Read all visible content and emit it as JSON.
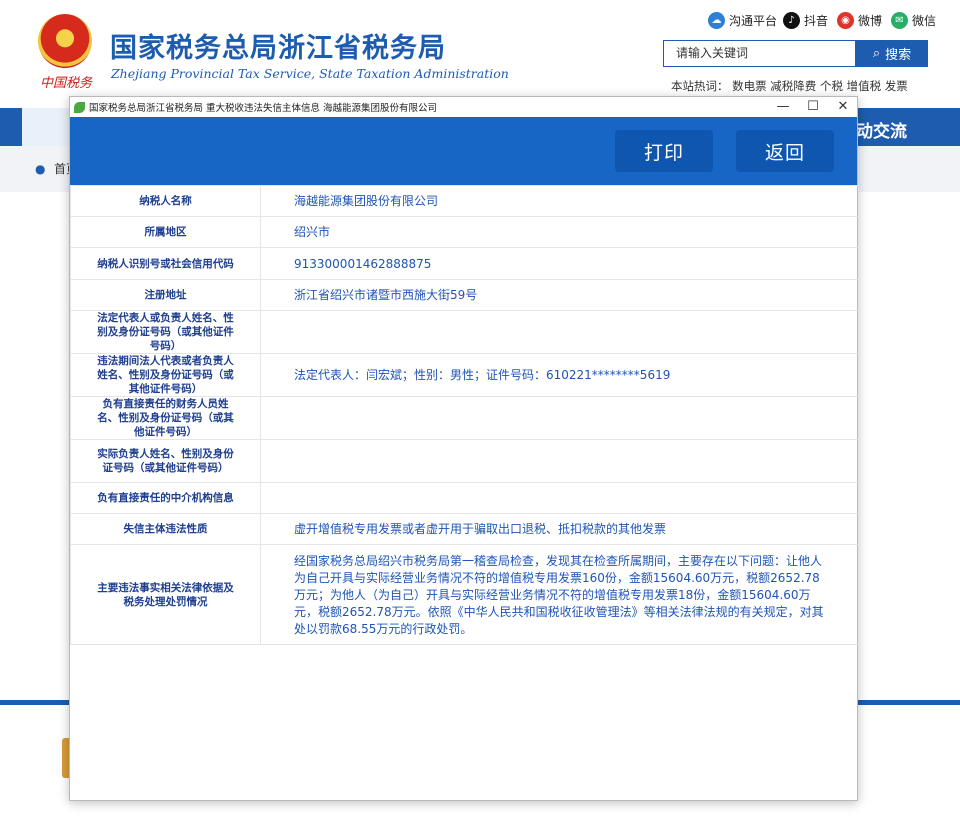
{
  "site": {
    "title": "国家税务总局浙江省税务局",
    "subtitle": "Zhejiang Provincial Tax Service, State Taxation Administration",
    "emblem_caption": "中国税务",
    "social": [
      {
        "label": "沟通平台",
        "icon": "cloud-icon",
        "color": "#2e7fd6"
      },
      {
        "label": "抖音",
        "icon": "douyin-icon",
        "color": "#111111"
      },
      {
        "label": "微博",
        "icon": "weibo-icon",
        "color": "#e0332b"
      },
      {
        "label": "微信",
        "icon": "wechat-icon",
        "color": "#2aae67"
      }
    ],
    "search_placeholder": "请输入关键词",
    "search_button": "搜索",
    "hot_words": "本站热词： 数电票 减税降费 个税 增值税 发票",
    "nav_partial_text": "动交流",
    "breadcrumb_partial": "首页",
    "colors": {
      "brand": "#1d5cae",
      "toolbar": "#1765c5"
    }
  },
  "window": {
    "title": "国家税务总局浙江省税务局 重大税收违法失信主体信息 海越能源集团股份有限公司",
    "controls": [
      "—",
      "☐",
      "✕"
    ],
    "print_button": "打印",
    "back_button": "返回"
  },
  "rows": [
    {
      "key": "纳税人名称",
      "value": "海越能源集团股份有限公司"
    },
    {
      "key": "所属地区",
      "value": "绍兴市"
    },
    {
      "key": "纳税人识别号或社会信用代码",
      "value": "913300001462888875"
    },
    {
      "key": "注册地址",
      "value": "浙江省绍兴市诸暨市西施大街59号"
    },
    {
      "key": "法定代表人或负责人姓名、性别及身份证号码（或其他证件号码）",
      "value": ""
    },
    {
      "key": "违法期间法人代表或者负责人姓名、性别及身份证号码（或其他证件号码）",
      "value": "法定代表人：闫宏斌；性别：男性；证件号码：610221********5619"
    },
    {
      "key": "负有直接责任的财务人员姓名、性别及身份证号码（或其他证件号码）",
      "value": ""
    },
    {
      "key": "实际负责人姓名、性别及身份证号码（或其他证件号码）",
      "value": ""
    },
    {
      "key": "负有直接责任的中介机构信息",
      "value": ""
    },
    {
      "key": "失信主体违法性质",
      "value": "虚开增值税专用发票或者虚开用于骗取出口退税、抵扣税款的其他发票"
    },
    {
      "key": "主要违法事实相关法律依据及税务处理处罚情况",
      "value": "经国家税务总局绍兴市税务局第一稽查局检查，发现其在检查所属期间，主要存在以下问题：让他人为自己开具与实际经营业务情况不符的增值税专用发票160份，金额15604.60万元，税额2652.78万元；为他人（为自己）开具与实际经营业务情况不符的增值税专用发票18份，金额15604.60万元，税额2652.78万元。依照《中华人民共和国税收征收管理法》等相关法律法规的有关规定，对其处以罚款68.55万元的行政处罚。"
    }
  ]
}
